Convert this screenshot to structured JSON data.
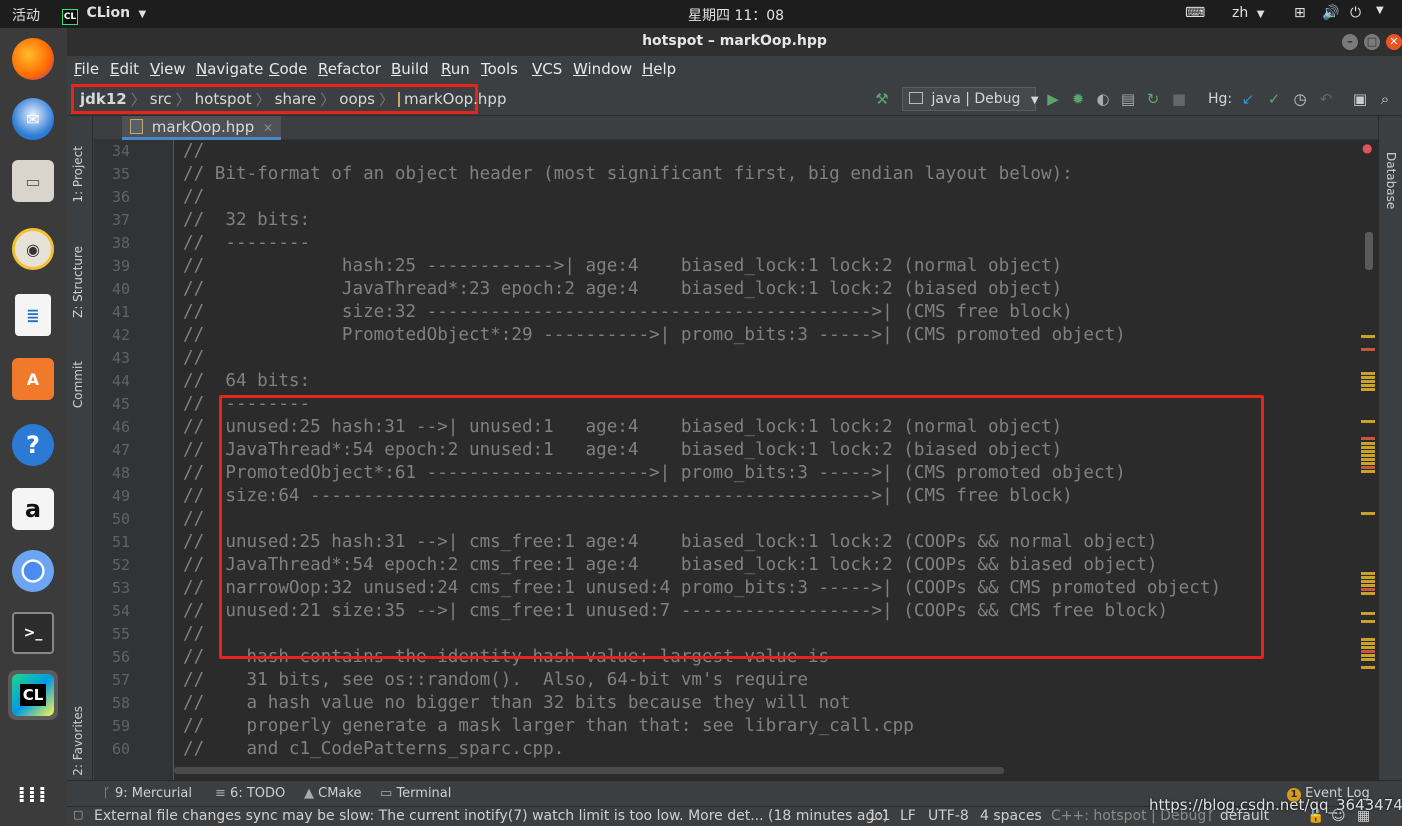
{
  "topbar": {
    "activities": "活动",
    "app_name": "CLion",
    "clock": "星期四 11：08",
    "input_method": "zh"
  },
  "window": {
    "title": "hotspot – markOop.hpp"
  },
  "menu": [
    "File",
    "Edit",
    "View",
    "Navigate",
    "Code",
    "Refactor",
    "Build",
    "Run",
    "Tools",
    "VCS",
    "Window",
    "Help"
  ],
  "breadcrumb": {
    "items": [
      "jdk12",
      "src",
      "hotspot",
      "share",
      "oops",
      "markOop.hpp"
    ]
  },
  "toolbar": {
    "run_config": "java | Debug",
    "hg_label": "Hg:"
  },
  "left_tools": {
    "project": "1: Project",
    "structure": "Z: Structure",
    "commit": "Commit",
    "favorites": "2: Favorites"
  },
  "right_tools": {
    "database": "Database"
  },
  "editor": {
    "tab_label": "markOop.hpp",
    "lines": [
      {
        "no": "34",
        "text": "//"
      },
      {
        "no": "35",
        "text": "// Bit-format of an object header (most significant first, big endian layout below):"
      },
      {
        "no": "36",
        "text": "//"
      },
      {
        "no": "37",
        "text": "//  32 bits:"
      },
      {
        "no": "38",
        "text": "//  --------"
      },
      {
        "no": "39",
        "text": "//             hash:25 ------------>| age:4    biased_lock:1 lock:2 (normal object)"
      },
      {
        "no": "40",
        "text": "//             JavaThread*:23 epoch:2 age:4    biased_lock:1 lock:2 (biased object)"
      },
      {
        "no": "41",
        "text": "//             size:32 ------------------------------------------>| (CMS free block)"
      },
      {
        "no": "42",
        "text": "//             PromotedObject*:29 ---------->| promo_bits:3 ----->| (CMS promoted object)"
      },
      {
        "no": "43",
        "text": "//"
      },
      {
        "no": "44",
        "text": "//  64 bits:"
      },
      {
        "no": "45",
        "text": "//  --------"
      },
      {
        "no": "46",
        "text": "//  unused:25 hash:31 -->| unused:1   age:4    biased_lock:1 lock:2 (normal object)"
      },
      {
        "no": "47",
        "text": "//  JavaThread*:54 epoch:2 unused:1   age:4    biased_lock:1 lock:2 (biased object)"
      },
      {
        "no": "48",
        "text": "//  PromotedObject*:61 --------------------->| promo_bits:3 ----->| (CMS promoted object)"
      },
      {
        "no": "49",
        "text": "//  size:64 ----------------------------------------------------->| (CMS free block)"
      },
      {
        "no": "50",
        "text": "//"
      },
      {
        "no": "51",
        "text": "//  unused:25 hash:31 -->| cms_free:1 age:4    biased_lock:1 lock:2 (COOPs && normal object)"
      },
      {
        "no": "52",
        "text": "//  JavaThread*:54 epoch:2 cms_free:1 age:4    biased_lock:1 lock:2 (COOPs && biased object)"
      },
      {
        "no": "53",
        "text": "//  narrowOop:32 unused:24 cms_free:1 unused:4 promo_bits:3 ----->| (COOPs && CMS promoted object)"
      },
      {
        "no": "54",
        "text": "//  unused:21 size:35 -->| cms_free:1 unused:7 ------------------>| (COOPs && CMS free block)"
      },
      {
        "no": "55",
        "text": "//"
      },
      {
        "no": "56",
        "text": "//  - hash contains the identity hash value: largest value is"
      },
      {
        "no": "57",
        "text": "//    31 bits, see os::random().  Also, 64-bit vm's require"
      },
      {
        "no": "58",
        "text": "//    a hash value no bigger than 32 bits because they will not"
      },
      {
        "no": "59",
        "text": "//    properly generate a mask larger than that: see library_call.cpp"
      },
      {
        "no": "60",
        "text": "//    and c1_CodePatterns_sparc.cpp."
      }
    ]
  },
  "bottom_tools": {
    "mercurial": "9: Mercurial",
    "todo": "6: TODO",
    "cmake": "CMake",
    "terminal": "Terminal",
    "event_log": "Event Log",
    "event_count": "1"
  },
  "status": {
    "message": "External file changes sync may be slow: The current inotify(7) watch limit is too low. More det... (18 minutes ago)",
    "position": "1:1",
    "line_sep": "LF",
    "encoding": "UTF-8",
    "indent": "4 spaces",
    "context": "C++: hotspot | Debug",
    "branch": "default"
  },
  "watermark": "https://blog.csdn.net/qq_36434742",
  "colors": {
    "highlight_box": "#e8231a",
    "comment": "#808080",
    "editor_bg": "#2b2b2b"
  }
}
